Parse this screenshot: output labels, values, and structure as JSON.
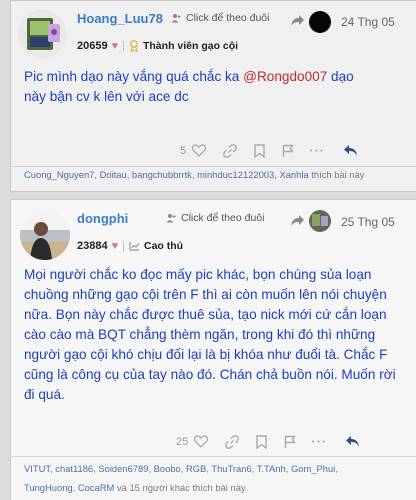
{
  "posts": [
    {
      "username": "Hoang_Luu78",
      "follow_label": "Click để theo đuôi",
      "date": "24 Thg 05",
      "score": "20659",
      "rank": "Thành viên gạo cội",
      "body_part1": "Pic mình dạo này vắng quá chắc ka ",
      "mention": "@Rongdo007",
      "body_part2": " dạo này bận cv k lên với ace dc",
      "like_count": "5",
      "liked_by": [
        "Cuong_Nguyen7",
        "Doitau",
        "bangchubbrrtk",
        "minhduc12122003",
        "Xanhla"
      ],
      "liked_suffix": "thích bài này"
    },
    {
      "username": "dongphi",
      "follow_label": "Click để theo đuôi",
      "date": "25 Thg 05",
      "score": "23884",
      "rank": "Cao thủ",
      "body": "Mọi người chắc ko đọc mấy pic khác, bọn chúng sủa loạn chuồng những gạo cội trên F thì ai còn muốn lên nói chuyện nữa. Bọn này chắc được thuê sủa, tạo nick mới cứ cắn loạn cào cào mà BQT chẳng thèm ngăn, trong khi đó thì những người gạo cội khó chịu đối lại là bị khóa như đuổi tà. Chắc F cũng là công cụ của tay nào đó. Chán chả buồn nói. Muốn rời đi quá.",
      "like_count": "25",
      "liked_by": [
        "VITUT",
        "chat1186",
        "Soiden6789",
        "Boobo",
        "RGB",
        "ThuTran6",
        "T.TAnh",
        "Gom_Phui",
        "TungHuong",
        "CocaRM"
      ],
      "liked_suffix": "và 15 người khác thích bài này"
    }
  ],
  "icons": {
    "follow": "person-plus-icon",
    "share_arrow": "share-arrow-icon",
    "heart": "heart-icon",
    "link": "link-icon",
    "bookmark": "bookmark-icon",
    "flag": "flag-icon",
    "more": "ellipsis-icon",
    "reply": "reply-icon",
    "rank_badge": "ribbon-icon",
    "rank_chart": "chart-icon"
  },
  "colors": {
    "username": "#3b7cc4",
    "body": "#1d3fbf",
    "mention": "#c2283a",
    "rank_badge": "#e3b93b",
    "reply": "#2a4f8a"
  }
}
